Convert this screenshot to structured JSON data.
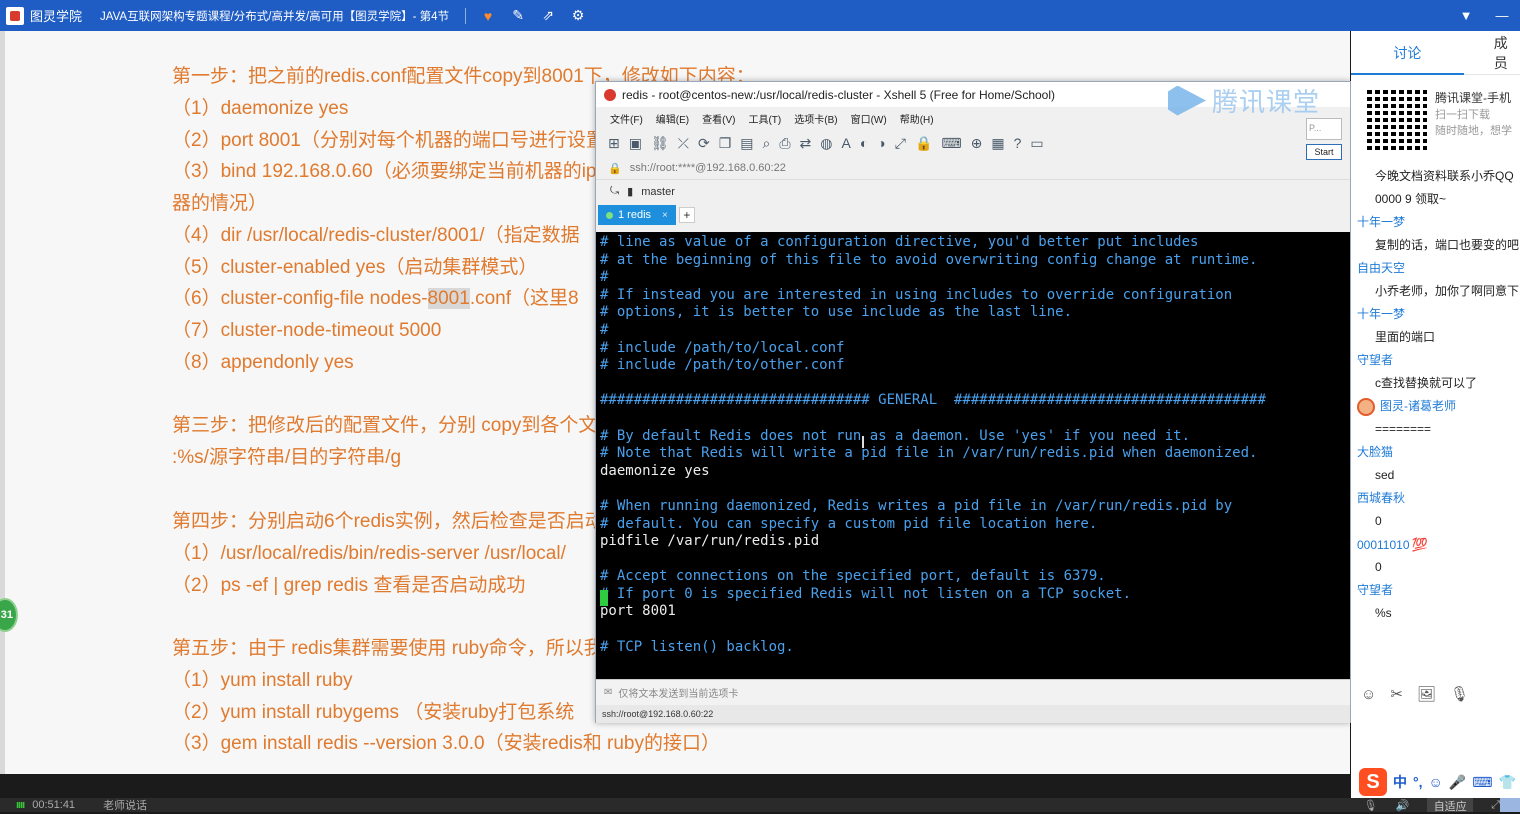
{
  "topbar": {
    "brand": "图灵学院",
    "course_title": "JAVA互联网架构专题课程/分布式/高并发/高可用【图灵学院】- 第4节",
    "icons": [
      "heart-icon",
      "edit-icon",
      "share-icon",
      "settings-icon"
    ],
    "dropdown_icon": "▼",
    "minimize_icon": "—"
  },
  "document": {
    "step1_title": "第一步：把之前的redis.conf配置文件copy到8001下，修改如下内容：",
    "items_step1": [
      "（1）daemonize yes",
      "（2）port 8001（分别对每个机器的端口号进行设置",
      "（3）bind 192.168.0.60（必须要绑定当前机器的ip",
      "器的情况）",
      "（4）dir /usr/local/redis-cluster/8001/（指定数据",
      "（5）cluster-enabled yes（启动集群模式）"
    ],
    "item6_pre": "（6）cluster-config-file nodes-",
    "item6_hl": "8001",
    "item6_post": ".conf（这里8",
    "items_step1_b": [
      "（7）cluster-node-timeout 5000",
      "（8）appendonly yes"
    ],
    "step3_title": "第三步：把修改后的配置文件，分别 copy到各个文",
    "step3_sub": ":%s/源字符串/目的字符串/g",
    "step4_title": "第四步：分别启动6个redis实例，然后检查是否启动",
    "step4_items": [
      "（1）/usr/local/redis/bin/redis-server /usr/local/",
      "（2）ps -ef | grep redis 查看是否启动成功"
    ],
    "step5_title": "第五步：由于 redis集群需要使用 ruby命令，所以我",
    "step5_items": [
      "（1）yum install ruby",
      "（2）yum install rubygems    （安装ruby打包系统",
      "（3）gem install redis  --version 3.0.0（安装redis和 ruby的接口）"
    ],
    "side_badge": "31"
  },
  "xshell": {
    "title": "redis - root@centos-new:/usr/local/redis-cluster - Xshell 5 (Free for Home/School)",
    "watermark": "腾讯课堂",
    "menu": [
      "文件(F)",
      "编辑(E)",
      "查看(V)",
      "工具(T)",
      "选项卡(B)",
      "窗口(W)",
      "帮助(H)"
    ],
    "address": "ssh://root:****@192.168.0.60:22",
    "quick_label": "master",
    "tab_label": "1 redis",
    "tab_close": "×",
    "tab_add": "+",
    "side_input_placeholder": "P...",
    "side_start": "Start",
    "terminal_lines": [
      {
        "t": "# line as value of a configuration directive, you'd better put includes",
        "c": "comment"
      },
      {
        "t": "# at the beginning of this file to avoid overwriting config change at runtime.",
        "c": "comment"
      },
      {
        "t": "#",
        "c": "comment"
      },
      {
        "t": "# If instead you are interested in using includes to override configuration",
        "c": "comment"
      },
      {
        "t": "# options, it is better to use include as the last line.",
        "c": "comment"
      },
      {
        "t": "#",
        "c": "comment"
      },
      {
        "t": "# include /path/to/local.conf",
        "c": "comment"
      },
      {
        "t": "# include /path/to/other.conf",
        "c": "comment"
      },
      {
        "t": "",
        "c": "plain"
      },
      {
        "t": "################################ GENERAL  #####################################",
        "c": "comment"
      },
      {
        "t": "",
        "c": "plain"
      },
      {
        "t": "# By default Redis does not run as a daemon. Use 'yes' if you need it.",
        "c": "comment"
      },
      {
        "t": "# Note that Redis will write a pid file in /var/run/redis.pid when daemonized.",
        "c": "comment"
      },
      {
        "t": "daemonize yes",
        "c": "plain"
      },
      {
        "t": "",
        "c": "plain"
      },
      {
        "t": "# When running daemonized, Redis writes a pid file in /var/run/redis.pid by",
        "c": "comment"
      },
      {
        "t": "# default. You can specify a custom pid file location here.",
        "c": "comment"
      },
      {
        "t": "pidfile /var/run/redis.pid",
        "c": "plain"
      },
      {
        "t": "",
        "c": "plain"
      },
      {
        "t": "# Accept connections on the specified port, default is 6379.",
        "c": "comment"
      },
      {
        "t": "# If port 0 is specified Redis will not listen on a TCP socket.",
        "c": "comment"
      },
      {
        "t": "port 8001",
        "c": "plain"
      },
      {
        "t": "",
        "c": "plain"
      },
      {
        "t": "# TCP listen() backlog.",
        "c": "comment"
      }
    ],
    "compose_placeholder": "仅将文本发送到当前选项卡",
    "status": "ssh://root@192.168.0.60:22"
  },
  "chat": {
    "tab_discuss": "讨论",
    "tab_second": "成员",
    "qr_title": "腾讯课堂-手机",
    "qr_sub1": "扫一扫下载",
    "qr_sub2": "随时随地，想学",
    "messages": [
      {
        "type": "text",
        "text": "今晚文档资料联系小乔QQ"
      },
      {
        "type": "text",
        "text": "0000 9 领取~"
      },
      {
        "type": "name",
        "text": "十年一梦"
      },
      {
        "type": "text",
        "text": "复制的话，端口也要变的吧"
      },
      {
        "type": "name",
        "text": "自由天空"
      },
      {
        "type": "text",
        "text": "小乔老师，加你了啊同意下"
      },
      {
        "type": "name",
        "text": "十年一梦"
      },
      {
        "type": "text",
        "text": "里面的端口"
      },
      {
        "type": "name",
        "text": "守望者"
      },
      {
        "type": "text",
        "text": "c查找替换就可以了"
      },
      {
        "type": "teacher",
        "text": "图灵-诸葛老师"
      },
      {
        "type": "text",
        "text": "========"
      },
      {
        "type": "name",
        "text": "大脸猫"
      },
      {
        "type": "text",
        "text": "sed"
      },
      {
        "type": "name",
        "text": "西城春秋"
      },
      {
        "type": "text",
        "text": "0"
      },
      {
        "type": "name100",
        "text": "00011010"
      },
      {
        "type": "text",
        "text": "0"
      },
      {
        "type": "name",
        "text": "守望者"
      },
      {
        "type": "text",
        "text": "%s"
      }
    ],
    "emoji_100": "💯",
    "tools": [
      "☺",
      "✂",
      "🖼",
      "🎙"
    ],
    "ime_logo": "S",
    "ime_items": [
      "中",
      "°,",
      "☺",
      "🎤",
      "⌨",
      "👕"
    ]
  },
  "bottombar": {
    "time": "00:51:41",
    "teacher_speaking": "老师说话",
    "fit": "自适应"
  }
}
